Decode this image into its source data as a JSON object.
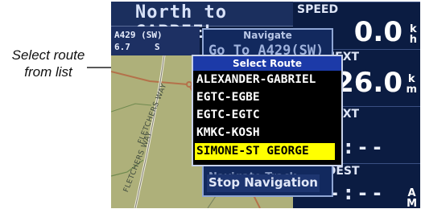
{
  "callout": {
    "line1": "Select route",
    "line2": "from list"
  },
  "header": {
    "title": "North to GABRIEL"
  },
  "info": {
    "waypoint": "A429 (SW)",
    "distance": "6.7",
    "bearing": "S"
  },
  "map": {
    "road1": "FLETCHERS WAY",
    "road2": "FLETCHERS WAY"
  },
  "fields": {
    "speed": {
      "label": "SPEED",
      "value": "0.0",
      "unit_top": "k",
      "unit_bottom": "h"
    },
    "dist_next": {
      "label": "T NEXT",
      "value": "26.0",
      "unit_top": "k",
      "unit_bottom": "m"
    },
    "eta_next": {
      "label": "E NEXT",
      "value": "-:--"
    },
    "to_dest": {
      "label": "A DEST",
      "value": "-:--",
      "unit_top": "A",
      "unit_bottom": "M"
    }
  },
  "navigate_menu": {
    "title": "Navigate",
    "goto": "Go To A429(SW)",
    "partial_item": "Navigate Track",
    "stop": "Stop Navigation"
  },
  "select_route": {
    "title": "Select Route",
    "routes": [
      "ALEXANDER-GABRIEL",
      "EGTC-EGBE",
      "EGTC-EGTC",
      "KMKC-KOSH",
      "SIMONE-ST GEORGE"
    ],
    "selected_index": 4
  },
  "colors": {
    "highlight": "#ffff00",
    "popup_header": "#1c3aa8",
    "screen_bg": "#0a1a3c"
  }
}
